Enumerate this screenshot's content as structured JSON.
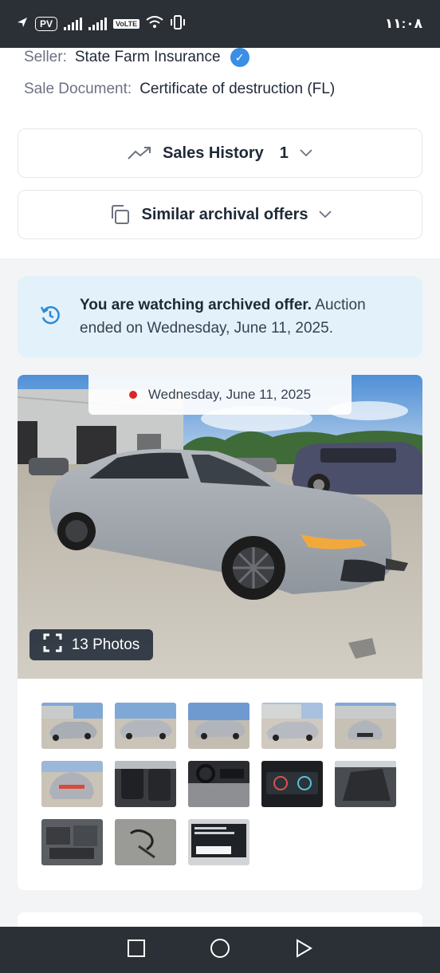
{
  "status_bar": {
    "badge": "PV",
    "volte": "VoLTE",
    "time": "١١:٠٨"
  },
  "seller": {
    "label": "Seller:",
    "value": "State Farm Insurance"
  },
  "sale_document": {
    "label": "Sale Document:",
    "value": "Certificate of destruction (FL)"
  },
  "sales_history": {
    "label": "Sales History",
    "count": "1"
  },
  "similar_offers": {
    "label": "Similar archival offers"
  },
  "notice": {
    "bold": "You are watching archived offer.",
    "rest": " Auction ended on Wednesday, June 11, 2025."
  },
  "photo": {
    "date": "Wednesday, June 11, 2025",
    "photos_label": "13 Photos"
  },
  "thumbnails": [
    {
      "name": "thumb-1",
      "desc": "front-left"
    },
    {
      "name": "thumb-2",
      "desc": "left side"
    },
    {
      "name": "thumb-3",
      "desc": "rear-left"
    },
    {
      "name": "thumb-4",
      "desc": "right side"
    },
    {
      "name": "thumb-5",
      "desc": "front"
    },
    {
      "name": "thumb-6",
      "desc": "rear"
    },
    {
      "name": "thumb-7",
      "desc": "interior seats"
    },
    {
      "name": "thumb-8",
      "desc": "dashboard"
    },
    {
      "name": "thumb-9",
      "desc": "instrument cluster"
    },
    {
      "name": "thumb-10",
      "desc": "rear seats"
    },
    {
      "name": "thumb-11",
      "desc": "engine bay"
    },
    {
      "name": "thumb-12",
      "desc": "parts"
    },
    {
      "name": "thumb-13",
      "desc": "label sticker"
    }
  ],
  "colors": {
    "accent": "#3b8ee6",
    "notice_bg": "#e3f1fb",
    "red_dot": "#dc2626",
    "status_bar": "#2b2f36"
  }
}
